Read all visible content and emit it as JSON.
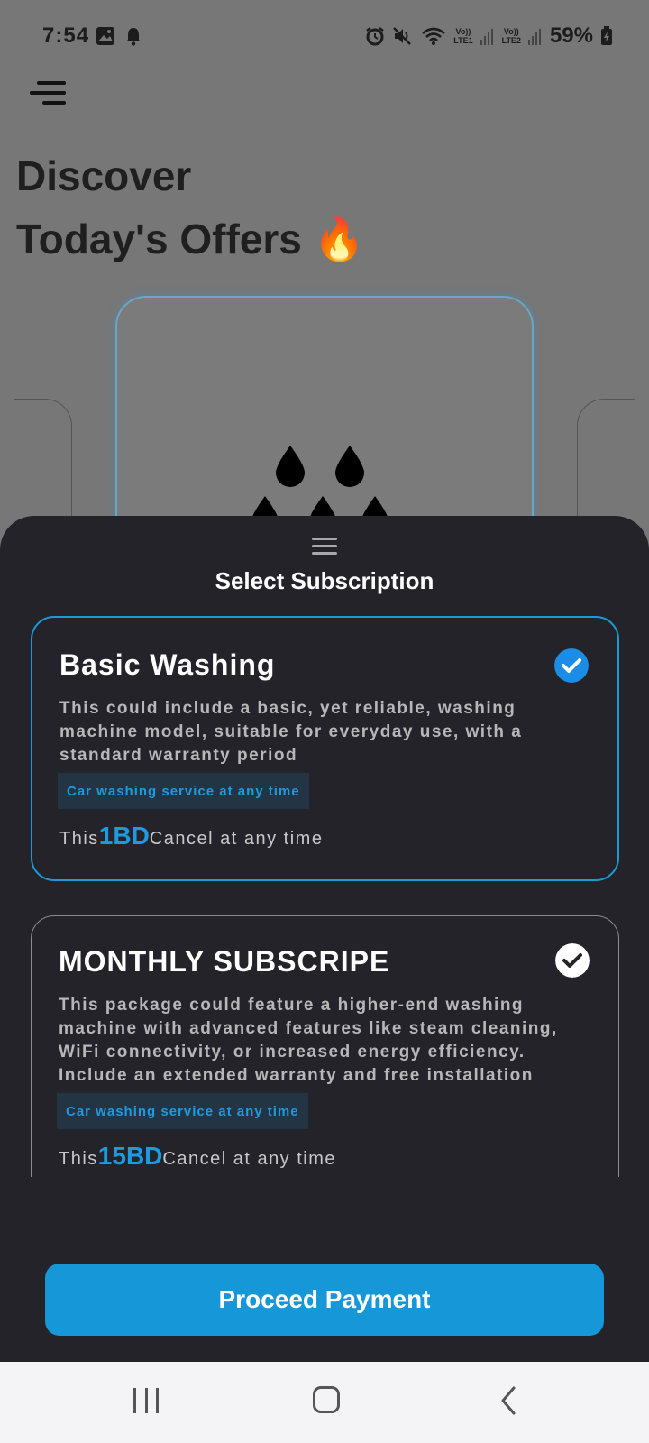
{
  "status_bar": {
    "time": "7:54",
    "battery": "59%",
    "sim1": "LTE1",
    "sim2": "LTE2",
    "volte": "Vo))",
    "icons": [
      "image-icon",
      "bell-icon",
      "alarm-icon",
      "mute-icon",
      "wifi-icon",
      "signal-icon",
      "battery-icon"
    ]
  },
  "page": {
    "headline_line1": "Discover",
    "headline_line2": "Today's Offers 🔥"
  },
  "sheet": {
    "title": "Select Subscription",
    "plans": [
      {
        "name": "Basic Washing",
        "description": "This could include a basic, yet reliable, washing machine model, suitable for everyday use, with a standard warranty period",
        "tag": "Car washing service at any time",
        "price_prefix": "This",
        "price": "1BD",
        "price_suffix": "Cancel at any time",
        "selected": true
      },
      {
        "name": "MONTHLY SUBSCRIPE",
        "description": "This package could feature a higher-end washing machine with advanced features like steam cleaning, WiFi connectivity, or increased energy efficiency. Include an extended warranty and free installation",
        "tag": "Car washing service at any time",
        "price_prefix": "This",
        "price": "15BD",
        "price_suffix": "Cancel at any time",
        "selected": false
      }
    ],
    "proceed_button": "Proceed Payment"
  },
  "colors": {
    "accent": "#1597d8",
    "sheet_bg": "#24232a",
    "tag_bg": "#233445",
    "overlay": "#777777"
  }
}
